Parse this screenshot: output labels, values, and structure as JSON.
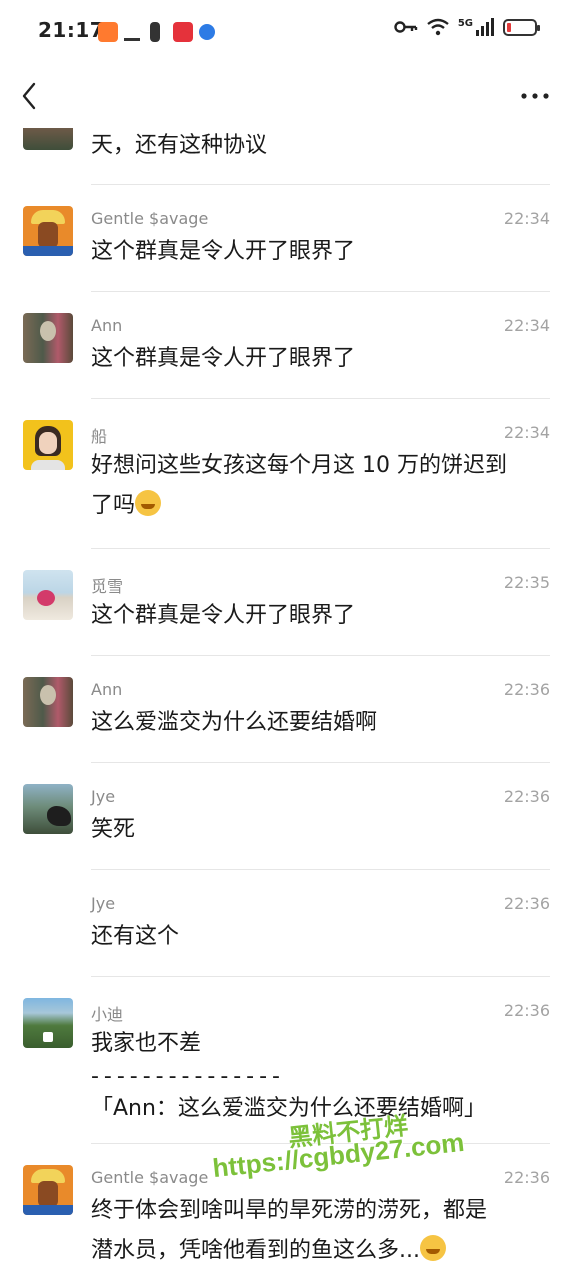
{
  "status_bar": {
    "time": "21:17",
    "network": "5G"
  },
  "messages": [
    {
      "id": "m0",
      "name": "",
      "time": "",
      "text": "天，还有这种协议"
    },
    {
      "id": "m1",
      "name": "Gentle $avage",
      "time": "22:34",
      "text": "这个群真是令人开了眼界了"
    },
    {
      "id": "m2",
      "name": "Ann",
      "time": "22:34",
      "text": "这个群真是令人开了眼界了"
    },
    {
      "id": "m3",
      "name": "船",
      "time": "22:34",
      "text_line1": "好想问这些女孩这每个月这 10 万的饼迟到",
      "text_line2": "了吗",
      "emoji": "crying-laughing-face"
    },
    {
      "id": "m4",
      "name": "觅雪",
      "time": "22:35",
      "text": "这个群真是令人开了眼界了"
    },
    {
      "id": "m5",
      "name": "Ann",
      "time": "22:36",
      "text": "这么爱滥交为什么还要结婚啊"
    },
    {
      "id": "m6",
      "name": "Jye",
      "time": "22:36",
      "text": "笑死"
    },
    {
      "id": "m7",
      "name": "Jye",
      "time": "22:36",
      "text": "还有这个"
    },
    {
      "id": "m8",
      "name": "小迪",
      "time": "22:36",
      "text": "我家也不差",
      "separator": "- - - - - - - - - - - - - - -",
      "quote": "「Ann：这么爱滥交为什么还要结婚啊」"
    },
    {
      "id": "m9",
      "name": "Gentle $avage",
      "time": "22:36",
      "text_line1": "终于体会到啥叫旱的旱死涝的涝死，都是",
      "text_line2": "潜水员，凭啥他看到的鱼这么多...",
      "emoji": "persevering-face"
    }
  ],
  "watermark": {
    "line1": "黑料不打烊",
    "line2": "https://cgbdy27.com"
  },
  "colors": {
    "name": "#8a8a8a",
    "time": "#a3a3a3",
    "watermark": "#7cc13a"
  }
}
